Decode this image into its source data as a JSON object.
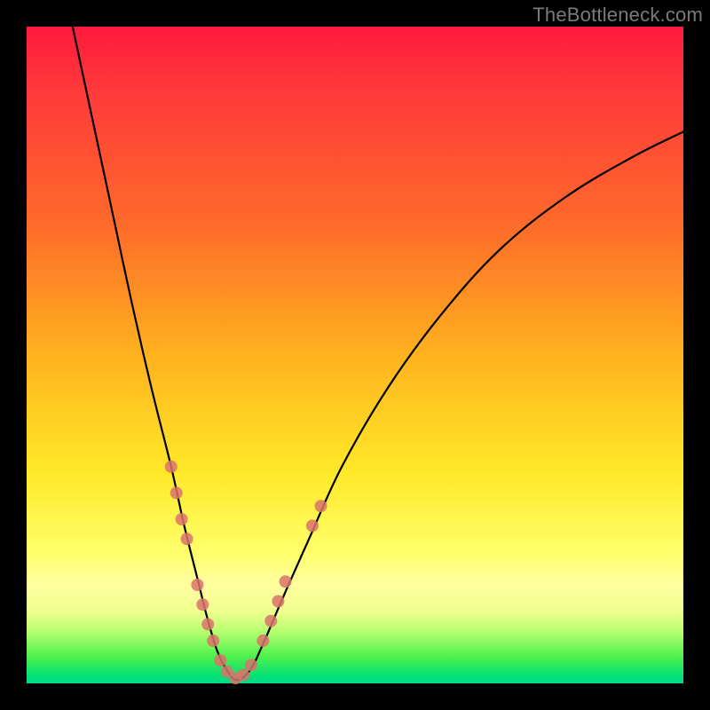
{
  "watermark": "TheBottleneck.com",
  "chart_data": {
    "type": "line",
    "title": "",
    "xlabel": "",
    "ylabel": "",
    "xlim": [
      0,
      100
    ],
    "ylim": [
      0,
      100
    ],
    "grid": false,
    "legend": false,
    "series": [
      {
        "name": "bottleneck-curve",
        "color": "#000000",
        "x": [
          7,
          10,
          13,
          16,
          19,
          22,
          24,
          26,
          27.5,
          29,
          30.5,
          32,
          34,
          36,
          39,
          43,
          48,
          55,
          63,
          72,
          82,
          92,
          100
        ],
        "y": [
          100,
          86,
          72,
          58,
          45,
          33,
          24,
          16,
          10,
          5,
          2,
          0.5,
          2,
          6,
          13,
          22,
          33,
          45,
          56,
          66,
          74,
          80,
          84
        ]
      }
    ],
    "markers": {
      "name": "highlight-dots",
      "color": "#d9736b",
      "radius_px": 7,
      "points": [
        {
          "x": 22.0,
          "y": 33
        },
        {
          "x": 22.8,
          "y": 29
        },
        {
          "x": 23.6,
          "y": 25
        },
        {
          "x": 24.4,
          "y": 22
        },
        {
          "x": 26.0,
          "y": 15
        },
        {
          "x": 26.8,
          "y": 12
        },
        {
          "x": 27.6,
          "y": 9
        },
        {
          "x": 28.4,
          "y": 6.5
        },
        {
          "x": 29.5,
          "y": 3.5
        },
        {
          "x": 30.5,
          "y": 1.8
        },
        {
          "x": 31.8,
          "y": 0.8
        },
        {
          "x": 33.0,
          "y": 1.3
        },
        {
          "x": 34.2,
          "y": 2.8
        },
        {
          "x": 36.0,
          "y": 6.5
        },
        {
          "x": 37.2,
          "y": 9.5
        },
        {
          "x": 38.3,
          "y": 12.5
        },
        {
          "x": 39.4,
          "y": 15.5
        },
        {
          "x": 43.5,
          "y": 24
        },
        {
          "x": 44.8,
          "y": 27
        }
      ]
    }
  }
}
